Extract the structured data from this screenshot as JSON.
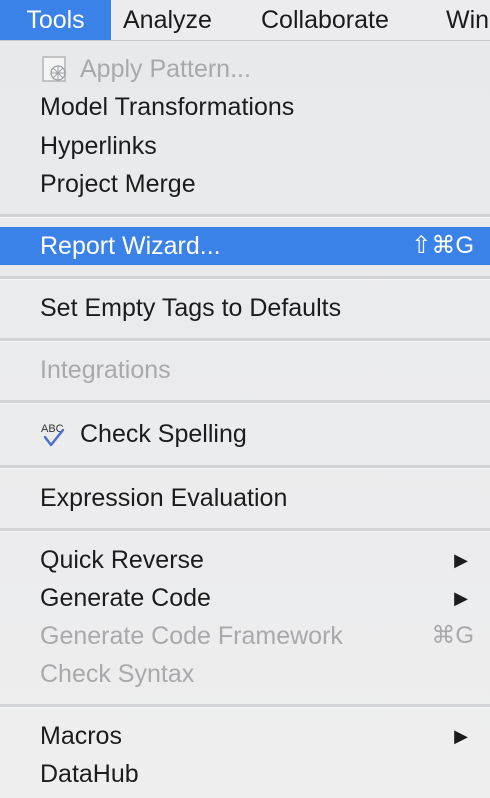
{
  "menubar": {
    "tools": "Tools",
    "analyze": "Analyze",
    "collaborate": "Collaborate",
    "window": "Win"
  },
  "menu": {
    "apply_pattern": "Apply Pattern...",
    "model_transformations": "Model Transformations",
    "hyperlinks": "Hyperlinks",
    "project_merge": "Project Merge",
    "report_wizard": "Report Wizard...",
    "report_wizard_shortcut": "⇧⌘G",
    "set_empty_tags": "Set Empty Tags to Defaults",
    "integrations": "Integrations",
    "check_spelling": "Check Spelling",
    "expression_evaluation": "Expression Evaluation",
    "quick_reverse": "Quick Reverse",
    "generate_code": "Generate Code",
    "generate_code_framework": "Generate Code Framework",
    "generate_code_framework_shortcut": "⌘G",
    "check_syntax": "Check Syntax",
    "macros": "Macros",
    "datahub": "DataHub",
    "submenu_arrow": "▶",
    "spell_icon_text": "ABC"
  },
  "colors": {
    "selection": "#3b82e8",
    "disabled_text": "#a9a9ac"
  },
  "icons": {
    "apply_pattern": "pattern-document-icon",
    "check_spelling": "spell-check-icon"
  }
}
